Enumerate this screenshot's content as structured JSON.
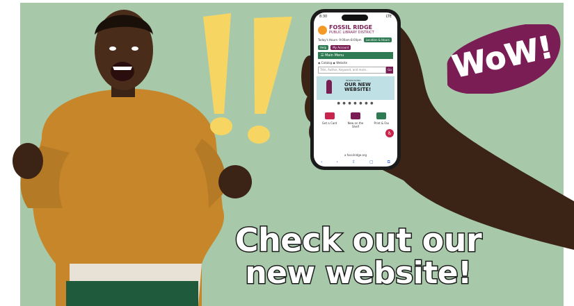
{
  "headline": {
    "line1": "Check out our",
    "line2": "new website!"
  },
  "sticker": {
    "text": "WoW!"
  },
  "phone": {
    "status": {
      "time": "8:30",
      "signal": "LTE"
    },
    "logo": {
      "line1": "FOSSIL RIDGE",
      "line2": "PUBLIC LIBRARY DISTRICT"
    },
    "hours": {
      "text": "Today's Hours: 9:00am-8:00pm",
      "location_label": "Location & Hours"
    },
    "buttons": {
      "help": "Help",
      "account": "My Account"
    },
    "menu_label": "Main Menu",
    "radios": {
      "catalog": "Catalog",
      "website": "Website"
    },
    "search": {
      "placeholder": "Title, Author, Keyword, and more...",
      "button": "Go"
    },
    "banner": {
      "small": "INTRODUCING",
      "line1": "OUR NEW",
      "line2": "WEBSITE!"
    },
    "dots": "● ● ● ● ● ● ●",
    "tiles": [
      {
        "label": "Get a Card"
      },
      {
        "label": "New on the Shelf"
      },
      {
        "label": "Print & Fax"
      }
    ],
    "url": "a fossilridge.org",
    "nav": [
      "‹",
      "›",
      "⇪",
      "▢",
      "⧉"
    ]
  },
  "colors": {
    "background": "#a7c9aa",
    "brand_purple": "#7a1d55",
    "brand_green": "#2e7a52",
    "exclaim_yellow": "#f6d562",
    "shirt_orange": "#c7862a"
  }
}
